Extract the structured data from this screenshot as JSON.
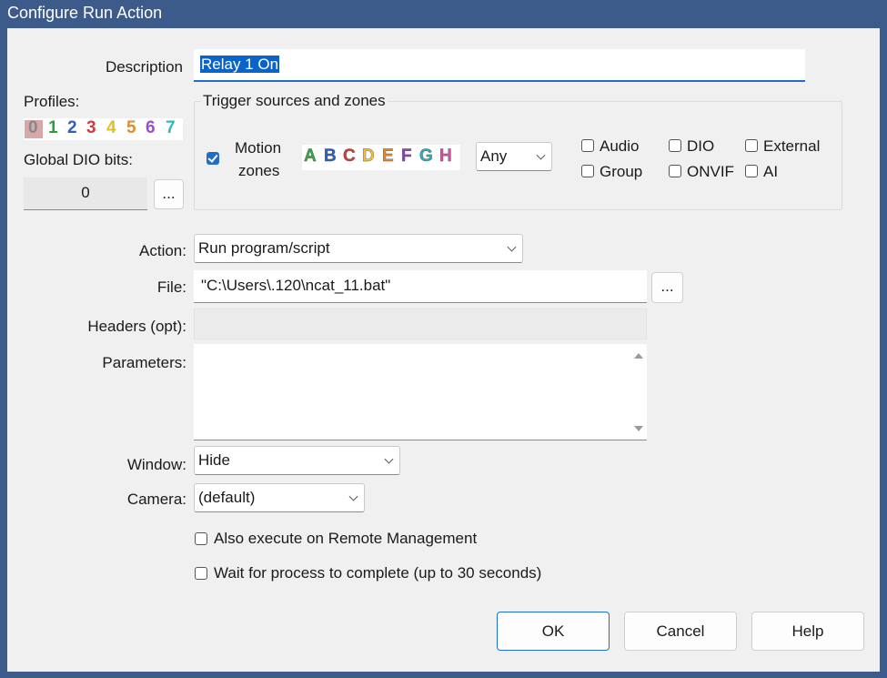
{
  "window": {
    "title": "Configure Run Action"
  },
  "description": {
    "label": "Description",
    "value": "Relay 1 On"
  },
  "profiles": {
    "label": "Profiles:",
    "items": [
      {
        "text": "0",
        "color": "#888888",
        "selected": true
      },
      {
        "text": "1",
        "color": "#2e9e3a"
      },
      {
        "text": "2",
        "color": "#2f5fbf"
      },
      {
        "text": "3",
        "color": "#d23b3b"
      },
      {
        "text": "4",
        "color": "#e0c020"
      },
      {
        "text": "5",
        "color": "#e58a2a"
      },
      {
        "text": "6",
        "color": "#9a4fc4"
      },
      {
        "text": "7",
        "color": "#32b8c0"
      }
    ],
    "dio_label": "Global DIO bits:",
    "dio_value": "0",
    "dio_button": "..."
  },
  "trigger": {
    "group_title": "Trigger sources and zones",
    "motion_label_1": "Motion",
    "motion_label_2": "zones",
    "motion_checked": true,
    "zones": [
      {
        "text": "A",
        "color": "#3aa845"
      },
      {
        "text": "B",
        "color": "#2f5fbf"
      },
      {
        "text": "C",
        "color": "#d23b3b"
      },
      {
        "text": "D",
        "color": "#f0c23a"
      },
      {
        "text": "E",
        "color": "#e58a2a"
      },
      {
        "text": "F",
        "color": "#8e44ad"
      },
      {
        "text": "G",
        "color": "#2bb0b8"
      },
      {
        "text": "H",
        "color": "#d44fa3"
      }
    ],
    "zone_mode": "Any",
    "sources": {
      "audio": "Audio",
      "dio": "DIO",
      "external": "External",
      "group": "Group",
      "onvif": "ONVIF",
      "ai": "AI"
    }
  },
  "action": {
    "label": "Action:",
    "value": "Run program/script"
  },
  "file": {
    "label": "File:",
    "value": "\"C:\\Users\\.120\\ncat_11.bat\"",
    "browse": "..."
  },
  "headers": {
    "label": "Headers (opt):",
    "value": ""
  },
  "parameters": {
    "label": "Parameters:",
    "value": ""
  },
  "window_mode": {
    "label": "Window:",
    "value": "Hide"
  },
  "camera": {
    "label": "Camera:",
    "value": "(default)"
  },
  "options": {
    "remote": "Also execute on Remote Management",
    "wait": "Wait for process to complete (up to 30 seconds)"
  },
  "buttons": {
    "ok": "OK",
    "cancel": "Cancel",
    "help": "Help"
  },
  "colors": {
    "titlebar": "#3c5a8a",
    "accent": "#1f6fc8",
    "selection": "#0a64c8"
  }
}
